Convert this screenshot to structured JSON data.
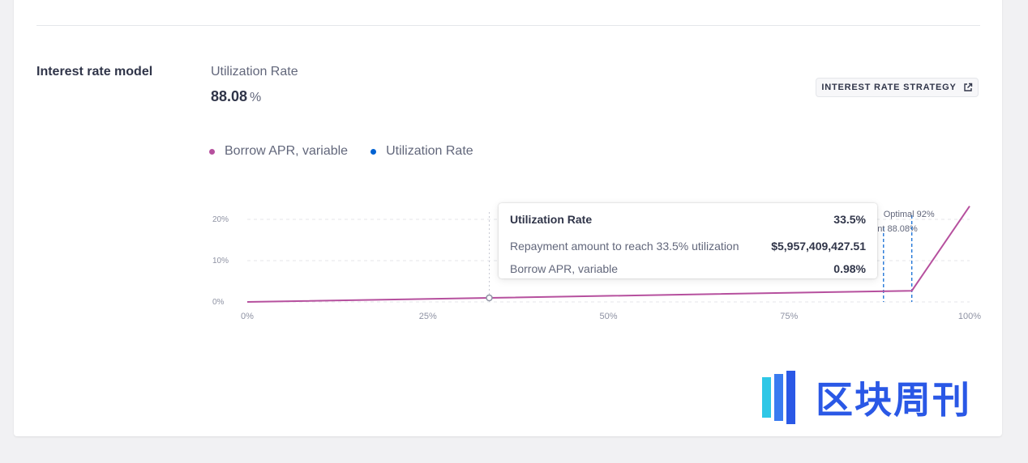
{
  "section": {
    "title": "Interest rate model"
  },
  "utilization": {
    "label": "Utilization Rate",
    "value": "88.08",
    "unit": "%"
  },
  "strategy_button": {
    "label": "INTEREST RATE STRATEGY",
    "icon": "external-link-icon"
  },
  "legend": [
    {
      "label": "Borrow APR, variable",
      "color": "#b6509e"
    },
    {
      "label": "Utilization Rate",
      "color": "#0062d2"
    }
  ],
  "tooltip": {
    "title": "Utilization Rate",
    "title_value": "33.5%",
    "repay_label": "Repayment amount to reach 33.5% utilization",
    "repay_value": "$5,957,409,427.51",
    "apr_label": "Borrow APR, variable",
    "apr_value": "0.98%"
  },
  "chart_data": {
    "type": "line",
    "title": "",
    "xlabel": "",
    "ylabel": "",
    "x_ticks": [
      "0%",
      "25%",
      "50%",
      "75%",
      "100%"
    ],
    "y_ticks": [
      "0%",
      "10%",
      "20%"
    ],
    "xlim": [
      0,
      100
    ],
    "ylim": [
      0,
      20
    ],
    "grid": true,
    "series": [
      {
        "name": "Borrow APR, variable",
        "color": "#b6509e",
        "points": [
          [
            0,
            0
          ],
          [
            33.5,
            0.98
          ],
          [
            92,
            2.7
          ],
          [
            100,
            23.2
          ]
        ]
      }
    ],
    "markers": [
      {
        "label": "Current 88.08%",
        "x": 88.08,
        "color": "#0062d2"
      },
      {
        "label": "Optimal 92%",
        "x": 92,
        "color": "#0062d2"
      }
    ],
    "hover": {
      "x": 33.5,
      "y": 0.98
    }
  },
  "watermark": {
    "text": "区块周刊"
  }
}
